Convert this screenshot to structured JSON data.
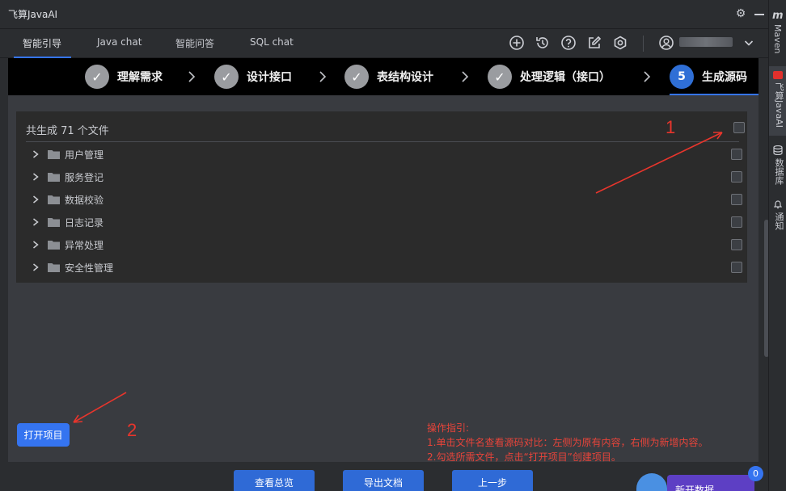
{
  "window": {
    "title": "飞算JavaAI"
  },
  "tabs": [
    {
      "label": "智能引导",
      "active": true
    },
    {
      "label": "Java chat",
      "active": false
    },
    {
      "label": "智能问答",
      "active": false
    },
    {
      "label": "SQL chat",
      "active": false
    }
  ],
  "toolbar_icons": [
    "add-circle-icon",
    "history-icon",
    "help-icon",
    "edit-icon",
    "settings-hex-icon",
    "user-icon",
    "chevron-down-icon"
  ],
  "steps": [
    {
      "label": "理解需求",
      "state": "done"
    },
    {
      "label": "设计接口",
      "state": "done"
    },
    {
      "label": "表结构设计",
      "state": "done"
    },
    {
      "label": "处理逻辑（接口）",
      "state": "done"
    },
    {
      "number": "5",
      "label": "生成源码",
      "state": "current"
    }
  ],
  "files": {
    "summary": "共生成 71 个文件",
    "items": [
      {
        "name": "用户管理"
      },
      {
        "name": "服务登记"
      },
      {
        "name": "数据校验"
      },
      {
        "name": "日志记录"
      },
      {
        "name": "异常处理"
      },
      {
        "name": "安全性管理"
      }
    ]
  },
  "actions": {
    "open_project": "打开项目",
    "view_overview": "查看总览",
    "export_doc": "导出文档",
    "prev_step": "上一步",
    "refresh_data": "新开数据",
    "badge_count": "0"
  },
  "guide": {
    "title": "操作指引:",
    "line1": "1.单击文件名查看源码对比：左侧为原有内容，右侧为新增内容。",
    "line2": "2.勾选所需文件，点击“打开项目”创建项目。"
  },
  "annotations": {
    "num1": "1",
    "num2": "2"
  },
  "right_strip": {
    "m": "m",
    "maven": "Maven",
    "javaai": "飞算JavaAI",
    "database": "数据库",
    "notifications": "通知"
  },
  "colors": {
    "accent": "#3574f0",
    "annotation": "#e8352c",
    "step_done": "#9a9ca0",
    "step_current": "#2f6fd6"
  }
}
